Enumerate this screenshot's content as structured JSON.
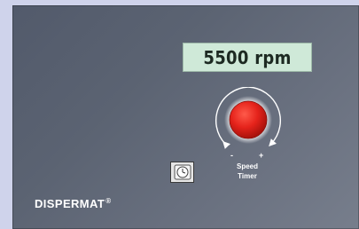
{
  "display": {
    "speed_readout": "5500 rpm"
  },
  "dial": {
    "minus_label": "-",
    "plus_label": "+",
    "speed_label": "Speed",
    "timer_label": "Timer",
    "button_color": "#e5231b"
  },
  "timer_button": {
    "icon": "clock-icon"
  },
  "brand": {
    "name": "DISPERMAT",
    "mark": "®"
  },
  "colors": {
    "panel": "#5b6372",
    "display_background": "#cfe9d8",
    "page_background": "#cfd3eb"
  }
}
